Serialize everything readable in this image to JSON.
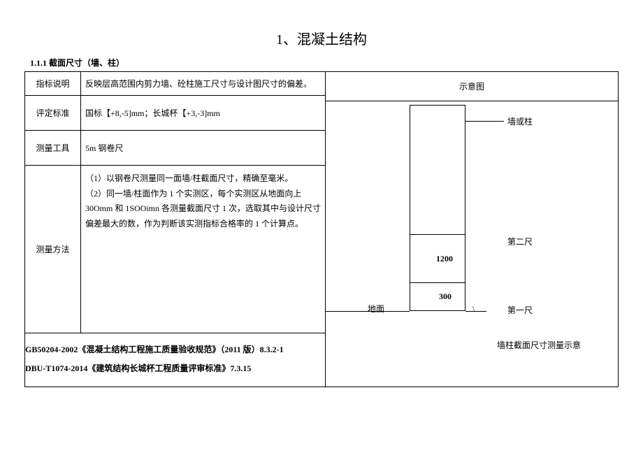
{
  "title": "1、混凝土结构",
  "section": "1.1.1 截面尺寸（墙、柱）",
  "rows": {
    "indicator_label": "指标说明",
    "indicator_content": "反映层高范围内剪力墙、砼柱施工尺寸与设计图尺寸的偏差。",
    "criteria_label": "评定标准",
    "criteria_content": "国标【+8,-5]mm；长城杯【+3,-3]mm",
    "tool_label": "测量工具",
    "tool_content": "5m 钢卷尺",
    "method_label": "测量方法",
    "method_content": "（1）以钢卷尺测量同一面墙/柱截面尺寸，精确至毫米。\n（2）同一墙/柱面作为 1 个实测区，每个实测区从地面向上 30Omm 和 1SOOimn 各测量截面尺寸 1 次，选取其中与设计尺寸偏差最大的数，作为判断该实测指标合格率的 1 个计算点。"
  },
  "diagram": {
    "header": "示意图",
    "label_wall": "墙或柱",
    "label_second": "第二尺",
    "label_first": "第一尺",
    "label_ground": "地面",
    "value_1200": "1200",
    "value_300": "300",
    "caption": "墙柱截面尺寸测量示意"
  },
  "references": {
    "ref1": "GB50204-2002《混凝土结构工程施工质量验收规范》（2011 版）8.3.2-1",
    "ref2": "DBU-T1074-2014《建筑结构长城杯工程质量评审标准》7.3.15"
  }
}
